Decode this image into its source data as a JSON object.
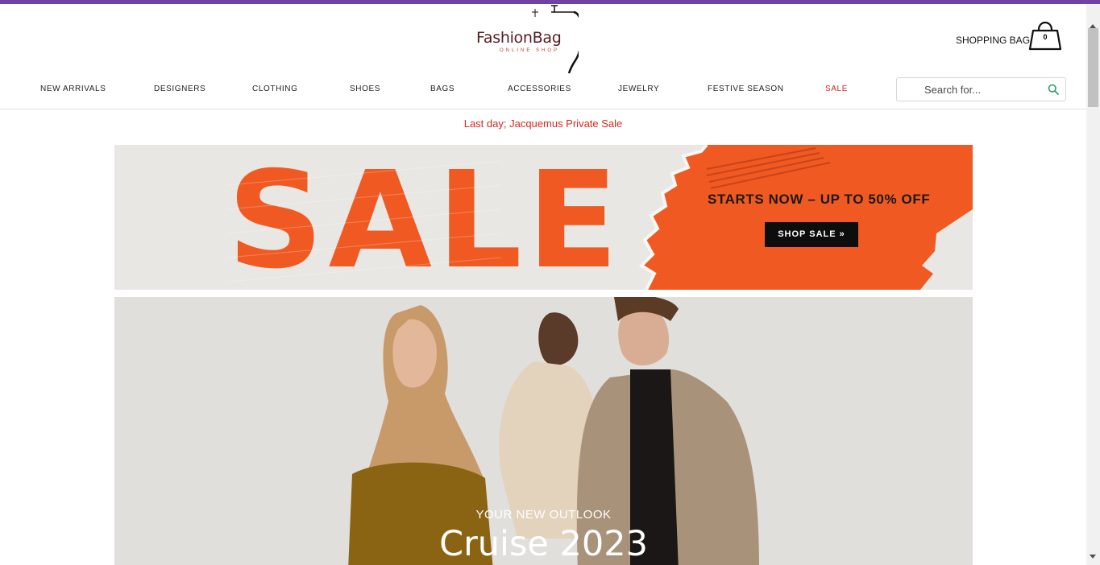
{
  "header": {
    "logo_text": "FashionBag",
    "logo_sub": "ONLINE SHOP",
    "bag_label": "SHOPPING BAG",
    "bag_count": "0"
  },
  "nav": {
    "items": [
      "NEW ARRIVALS",
      "DESIGNERS",
      "CLOTHING",
      "SHOES",
      "BAGS",
      "ACCESSORIES",
      "JEWELRY",
      "FESTIVE SEASON",
      "SALE"
    ]
  },
  "search": {
    "placeholder": "Search for..."
  },
  "promo": {
    "text": "Last day; Jacquemus Private Sale"
  },
  "sale_banner": {
    "word": "SALE",
    "headline": "STARTS NOW – UP TO 50% OFF",
    "button_label": "SHOP SALE »"
  },
  "hero": {
    "eyebrow": "YOUR NEW OUTLOOK",
    "title": "Cruise 2023"
  },
  "colors": {
    "accent_bar": "#6f42a8",
    "sale_red": "#d9281c",
    "sale_orange": "#f05a22",
    "search_icon": "#2aa06a"
  },
  "icons": {
    "bag": "shopping-bag-icon",
    "search": "search-icon",
    "logo_mark": "hanger-logo-icon"
  }
}
